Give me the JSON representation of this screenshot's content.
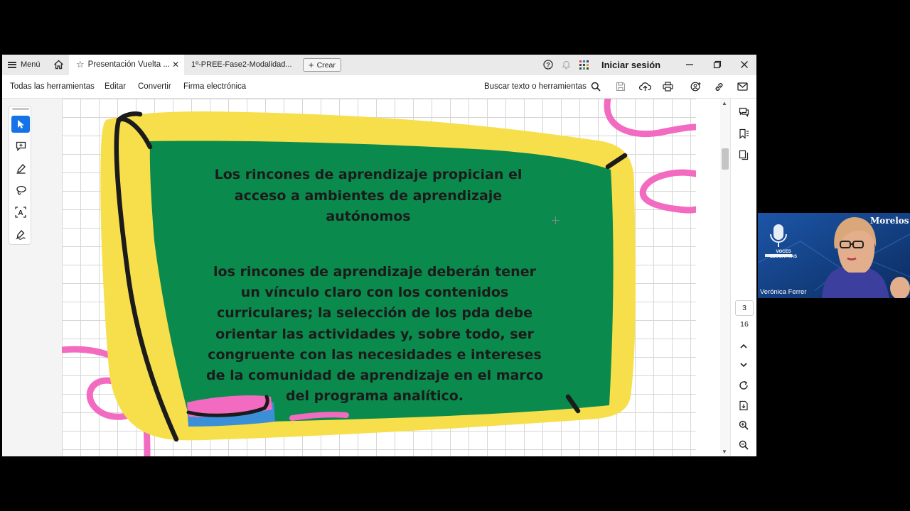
{
  "tabbar": {
    "menu_label": "Menú",
    "active_tab_label": "Presentación Vuelta ...",
    "second_tab_label": "1º-PREE-Fase2-Modalidad...",
    "create_label": "Crear",
    "signin_label": "Iniciar sesión"
  },
  "toolbar": {
    "all_tools": "Todas las herramientas",
    "edit": "Editar",
    "convert": "Convertir",
    "esign": "Firma electrónica",
    "search": "Buscar texto o herramientas"
  },
  "slide": {
    "title": "Los rincones de aprendizaje propician el acceso a ambientes de aprendizaje autónomos",
    "body": "los rincones de aprendizaje deberán tener un vínculo claro con los contenidos curriculares; la selección de los pda debe orientar las actividades y, sobre todo, ser congruente con las necesidades e intereses de la comunidad de aprendizaje en el marco del programa analítico."
  },
  "pagination": {
    "current": "3",
    "total": "16"
  },
  "webcam": {
    "participant_name": "Verónica Ferrer",
    "state_label": "Morelos",
    "logo_text": "VOCES EDUCATIVAS"
  },
  "colors": {
    "chalkboard": "#0a8a4c",
    "frame": "#f7df4b",
    "pink": "#f26bc0",
    "accent_blue": "#1473e6"
  }
}
